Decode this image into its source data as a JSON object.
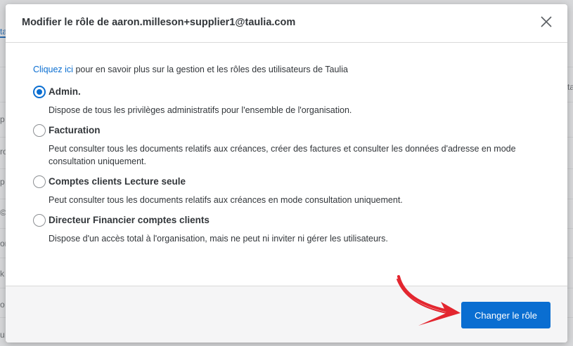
{
  "background": {
    "fragments": [
      "ta",
      "p",
      "ro",
      "p",
      "©",
      "on",
      "k",
      "o",
      "u",
      "ta"
    ]
  },
  "modal": {
    "title": "Modifier le rôle de aaron.milleson+supplier1@taulia.com",
    "info_link": "Cliquez ici",
    "info_text": " pour en savoir plus sur la gestion et les rôles des utilisateurs de Taulia",
    "roles": [
      {
        "label": "Admin.",
        "description": "Dispose de tous les privilèges administratifs pour l'ensemble de l'organisation.",
        "selected": true
      },
      {
        "label": "Facturation",
        "description": "Peut consulter tous les documents relatifs aux créances, créer des factures et consulter les données d'adresse en mode consultation uniquement.",
        "selected": false
      },
      {
        "label": "Comptes clients Lecture seule",
        "description": "Peut consulter tous les documents relatifs aux créances en mode consultation uniquement.",
        "selected": false
      },
      {
        "label": "Directeur Financier comptes clients",
        "description": "Dispose d'un accès total à l'organisation, mais ne peut ni inviter ni gérer les utilisateurs.",
        "selected": false
      }
    ],
    "submit_label": "Changer le rôle"
  },
  "colors": {
    "primary": "#0a6ed1",
    "annotation_arrow": "#e3262f"
  },
  "icons": {
    "close": "close-icon",
    "arrow": "annotation-arrow-icon"
  }
}
